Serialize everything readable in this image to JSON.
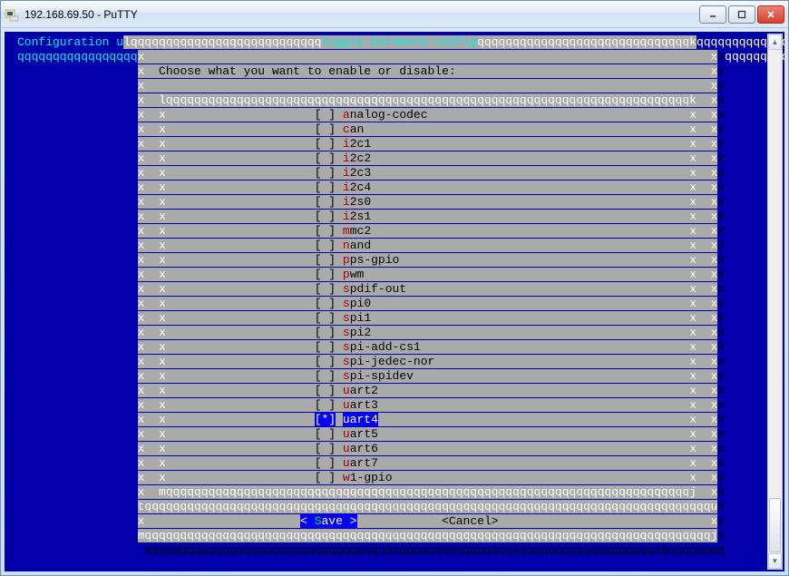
{
  "window": {
    "title": "192.168.69.50 - PuTTY"
  },
  "header": {
    "left": "Configuration u",
    "title": "Toggle hardware config"
  },
  "prompt": "Choose what you want to enable or disable:",
  "items": [
    {
      "label": "analog-codec",
      "checked": false,
      "selected": false
    },
    {
      "label": "can",
      "checked": false,
      "selected": false
    },
    {
      "label": "i2c1",
      "checked": false,
      "selected": false
    },
    {
      "label": "i2c2",
      "checked": false,
      "selected": false
    },
    {
      "label": "i2c3",
      "checked": false,
      "selected": false
    },
    {
      "label": "i2c4",
      "checked": false,
      "selected": false
    },
    {
      "label": "i2s0",
      "checked": false,
      "selected": false
    },
    {
      "label": "i2s1",
      "checked": false,
      "selected": false
    },
    {
      "label": "mmc2",
      "checked": false,
      "selected": false
    },
    {
      "label": "nand",
      "checked": false,
      "selected": false
    },
    {
      "label": "pps-gpio",
      "checked": false,
      "selected": false
    },
    {
      "label": "pwm",
      "checked": false,
      "selected": false
    },
    {
      "label": "spdif-out",
      "checked": false,
      "selected": false
    },
    {
      "label": "spi0",
      "checked": false,
      "selected": false
    },
    {
      "label": "spi1",
      "checked": false,
      "selected": false
    },
    {
      "label": "spi2",
      "checked": false,
      "selected": false
    },
    {
      "label": "spi-add-cs1",
      "checked": false,
      "selected": false
    },
    {
      "label": "spi-jedec-nor",
      "checked": false,
      "selected": false
    },
    {
      "label": "spi-spidev",
      "checked": false,
      "selected": false
    },
    {
      "label": "uart2",
      "checked": false,
      "selected": false
    },
    {
      "label": "uart3",
      "checked": false,
      "selected": false
    },
    {
      "label": "uart4",
      "checked": true,
      "selected": true
    },
    {
      "label": "uart5",
      "checked": false,
      "selected": false
    },
    {
      "label": "uart6",
      "checked": false,
      "selected": false
    },
    {
      "label": "uart7",
      "checked": false,
      "selected": false
    },
    {
      "label": "w1-gpio",
      "checked": false,
      "selected": false
    }
  ],
  "buttons": {
    "save": "Save",
    "cancel": "Cancel"
  }
}
